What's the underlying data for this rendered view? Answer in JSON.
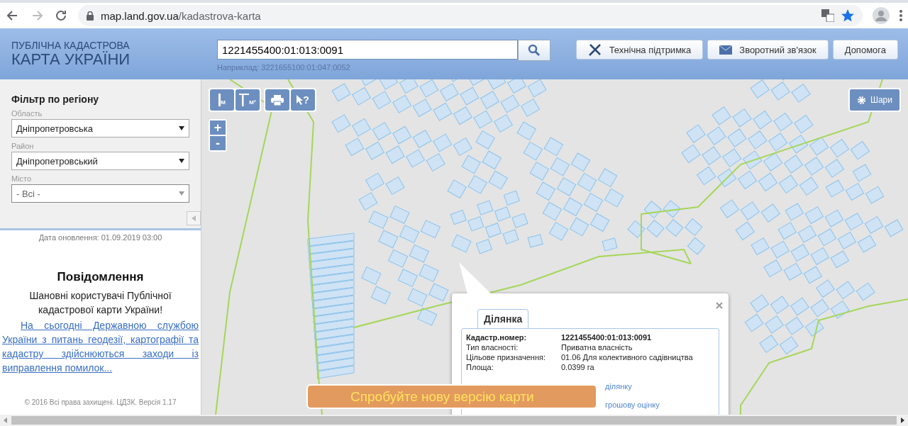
{
  "browser": {
    "url_host": "map.land.gov.ua",
    "url_path": "/kadastrova-karta",
    "bookmarked": true
  },
  "header": {
    "logo_line1": "ПУБЛІЧНА КАДАСТРОВА",
    "logo_line2": "КАРТА УКРАЇНИ",
    "search_value": "1221455400:01:013:0091",
    "search_hint": "Наприклад: 3221655100:01:047:0052",
    "buttons": [
      {
        "label": "Технічна підтримка",
        "kind": "support"
      },
      {
        "label": "Зворотний зв'язок",
        "kind": "feedback"
      },
      {
        "label": "Допомога",
        "kind": "help"
      }
    ]
  },
  "filter": {
    "title": "Фільтр по регіону",
    "fields": [
      {
        "label": "Область",
        "value": "Дніпропетровська",
        "disabled": false
      },
      {
        "label": "Район",
        "value": "Дніпропетровський",
        "disabled": false
      },
      {
        "label": "Місто",
        "value": "- Всі -",
        "disabled": true
      }
    ]
  },
  "update_date": "Дата оновлення: 01.09.2019 03:00",
  "notice": {
    "title": "Повідомлення",
    "greeting": "Шановні користувачі Публічної кадастрової карти України!",
    "link": "На сьогодні Державною службою України з питань геодезії, картографії та кадастру здійснюються заходи із виправлення помилок..."
  },
  "footer": "© 2016 Всі права захищені. ЦДЗК. Версія 1.17",
  "map": {
    "tools": [
      {
        "kind": "length",
        "sub": "М"
      },
      {
        "kind": "area",
        "sub": "М²"
      },
      {
        "kind": "print"
      },
      {
        "kind": "identify",
        "sub": "?"
      }
    ],
    "zoom": [
      "+",
      "-"
    ],
    "layers_button": "Шари"
  },
  "popup": {
    "tab": "Ділянка",
    "rows": [
      {
        "label": "Кадастр.номер:",
        "value": "1221455400:01:013:0091",
        "bold": true
      },
      {
        "label": "Тип власності:",
        "value": "Приватна власність",
        "bold": false
      },
      {
        "label": "Цільове призначення:",
        "value": "01.06 Для колективного садівництва",
        "bold": false
      },
      {
        "label": "Площа:",
        "value": "0.0399 га",
        "bold": false
      }
    ],
    "links": [
      "ділянку",
      "грошову оцінку"
    ]
  },
  "banner": "Спробуйте нову версію карти"
}
